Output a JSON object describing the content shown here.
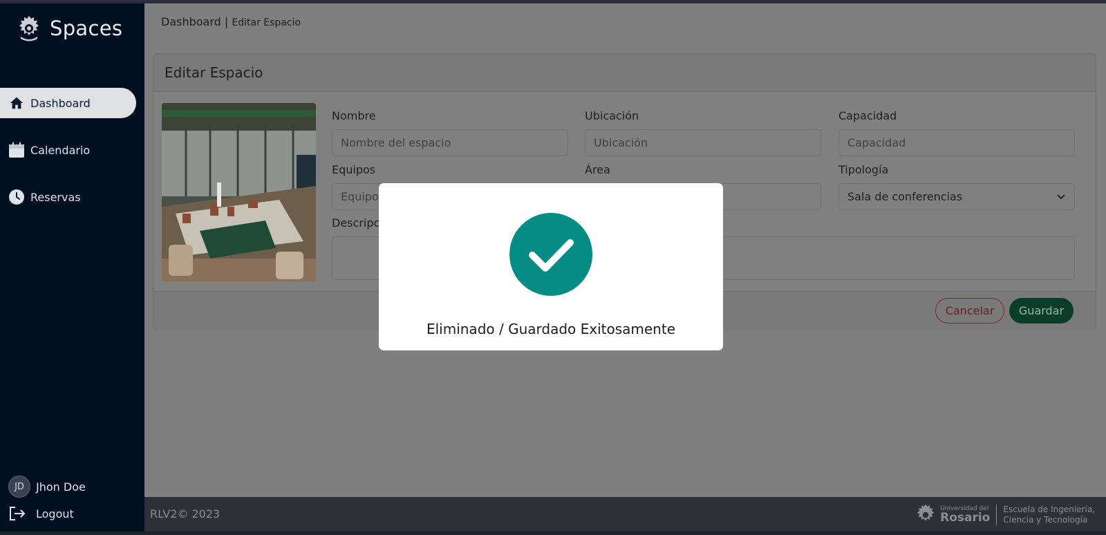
{
  "sidebar": {
    "brand": "Spaces",
    "items": [
      {
        "label": "Dashboard",
        "icon": "home-icon",
        "active": true
      },
      {
        "label": "Calendario",
        "icon": "calendar-icon",
        "active": false
      },
      {
        "label": "Reservas",
        "icon": "clock-icon",
        "active": false
      }
    ],
    "user": {
      "initials": "JD",
      "name": "Jhon Doe"
    },
    "logout_label": "Logout"
  },
  "breadcrumb": {
    "root": "Dashboard",
    "separator": "|",
    "current": "Editar Espacio"
  },
  "card": {
    "title": "Editar Espacio",
    "fields": {
      "nombre": {
        "label": "Nombre",
        "placeholder": "Nombre del espacio"
      },
      "ubicacion": {
        "label": "Ubicación",
        "placeholder": "Ubicación"
      },
      "capacidad": {
        "label": "Capacidad",
        "placeholder": "Capacidad"
      },
      "equipos": {
        "label": "Equipos",
        "placeholder": "Equipos"
      },
      "area": {
        "label": "Área"
      },
      "tipologia": {
        "label": "Tipología",
        "value": "Sala de conferencias"
      },
      "descripcion": {
        "label": "Descripción"
      }
    },
    "cancel_label": "Cancelar",
    "save_label": "Guardar"
  },
  "modal": {
    "message": "Eliminado / Guardado Exitosamente",
    "icon": "check-circle-icon",
    "accent": "#058c84"
  },
  "footer": {
    "copyright": "RLV2© 2023",
    "logo_small": "Universidad del",
    "logo_big": "Rosario",
    "school_line1": "Escuela de Ingeniería,",
    "school_line2": "Ciencia y Tecnología"
  }
}
